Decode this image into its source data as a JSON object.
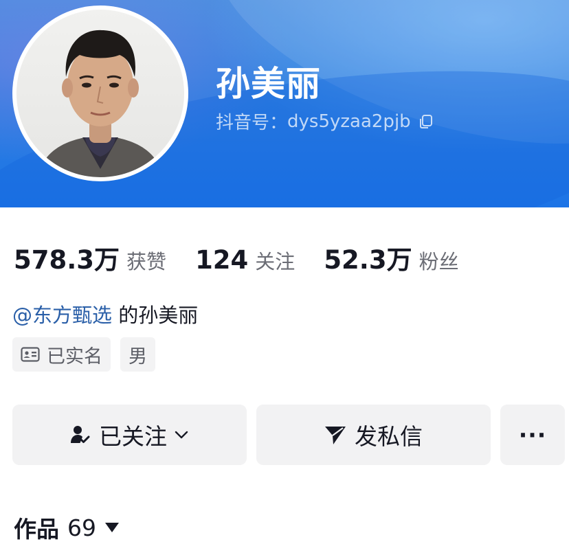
{
  "profile": {
    "name": "孙美丽",
    "douyin_id_label": "抖音号：",
    "douyin_id": "dys5yzaa2pjb",
    "avatar_icon": "profile-photo"
  },
  "stats": [
    {
      "value": "578.3万",
      "label": "获赞"
    },
    {
      "value": "124",
      "label": "关注"
    },
    {
      "value": "52.3万",
      "label": "粉丝"
    }
  ],
  "bio": {
    "mention": "@东方甄选",
    "text": " 的孙美丽"
  },
  "tags": {
    "verified": "已实名",
    "gender": "男"
  },
  "actions": {
    "follow_label": "已关注",
    "message_label": "发私信",
    "more_label": "···"
  },
  "works_tab": {
    "label": "作品",
    "count": "69"
  },
  "colors": {
    "header_blue": "#1c74e6",
    "mention_blue": "#2a5fa8",
    "button_bg": "#f2f2f3"
  }
}
